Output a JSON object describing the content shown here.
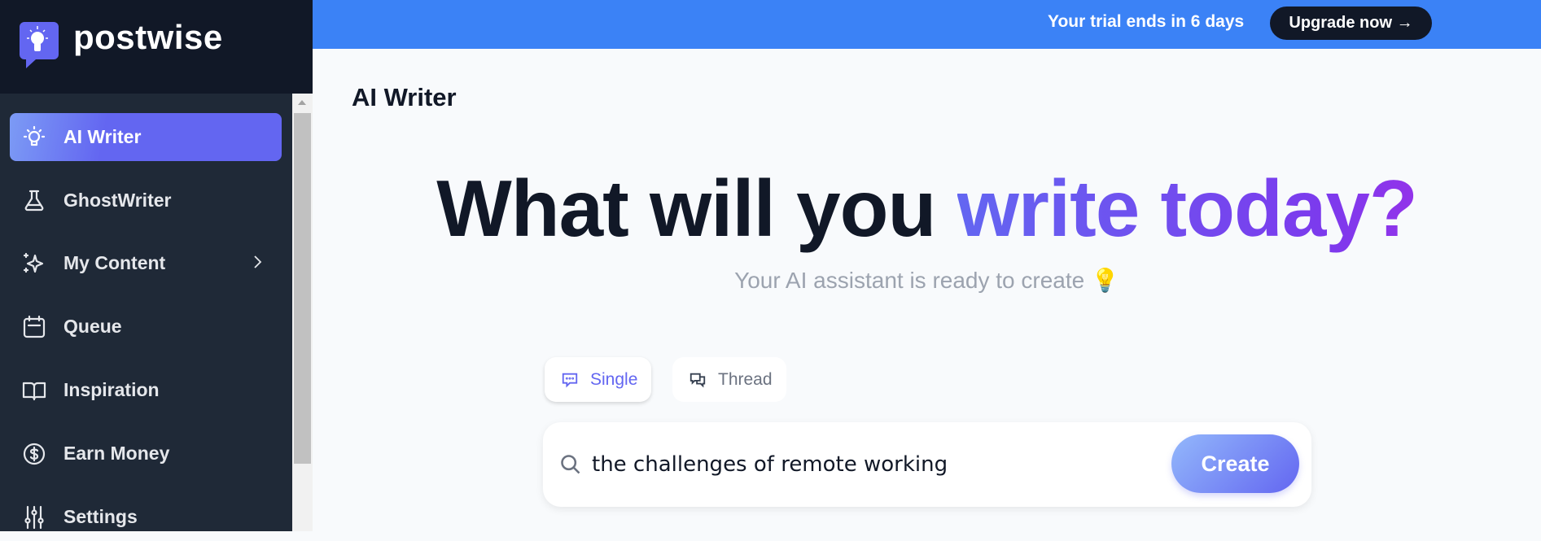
{
  "brand": {
    "name": "postwise",
    "accent": "#6366f1"
  },
  "banner": {
    "text": "Your trial ends in 6 days",
    "button": "Upgrade now →",
    "color": "#3b82f6"
  },
  "sidebar": {
    "items": [
      {
        "label": "AI Writer",
        "icon": "lightbulb-icon",
        "active": true
      },
      {
        "label": "GhostWriter",
        "icon": "flask-icon"
      },
      {
        "label": "My Content",
        "icon": "sparkles-icon",
        "has_submenu": true
      },
      {
        "label": "Queue",
        "icon": "calendar-icon"
      },
      {
        "label": "Inspiration",
        "icon": "book-open-icon"
      },
      {
        "label": "Earn Money",
        "icon": "dollar-circle-icon"
      },
      {
        "label": "Settings",
        "icon": "sliders-icon"
      }
    ]
  },
  "main": {
    "title": "AI Writer",
    "headline_a": "What will you ",
    "headline_b": "write today?",
    "subtitle": "Your AI assistant is ready to create",
    "subtitle_emoji": "💡",
    "tabs": [
      {
        "label": "Single",
        "active": true
      },
      {
        "label": "Thread"
      }
    ],
    "search": {
      "value": "the challenges of remote working",
      "button": "Create"
    }
  }
}
